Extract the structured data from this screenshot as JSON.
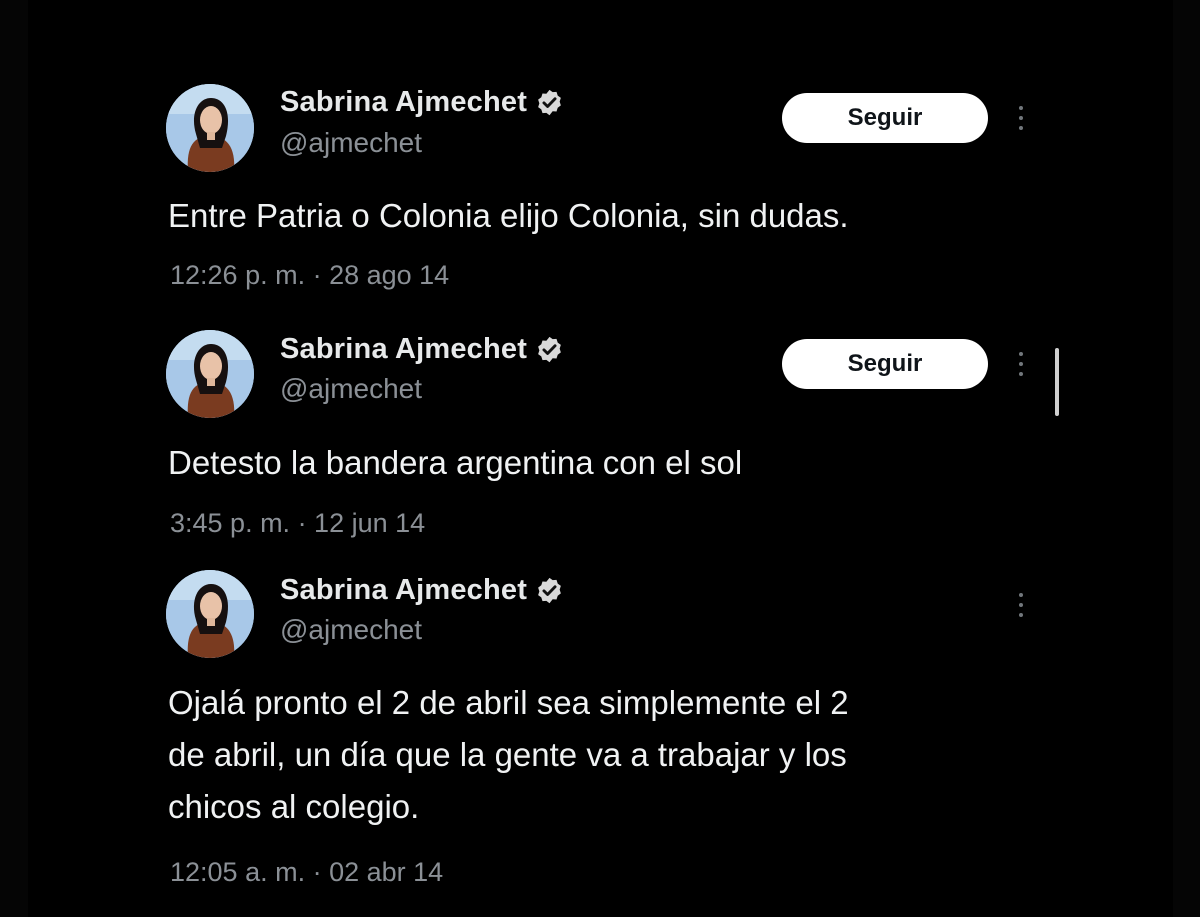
{
  "colors": {
    "background": "#000000",
    "verified_badge": "#d9d9d9",
    "follow_button_bg": "#ffffff",
    "text_primary": "#e7e9ea",
    "text_secondary": "#8b9096"
  },
  "tweets": [
    {
      "author": {
        "name": "Sabrina Ajmechet",
        "handle": "@ajmechet",
        "verified_icon": "verified-badge-icon",
        "avatar_icon": "avatar"
      },
      "follow_label": "Seguir",
      "more_icon": "more-options-icon",
      "text": "Entre Patria o Colonia elijo Colonia, sin dudas.",
      "timestamp": "12:26 p. m. · 28 ago 14"
    },
    {
      "author": {
        "name": "Sabrina Ajmechet",
        "handle": "@ajmechet",
        "verified_icon": "verified-badge-icon",
        "avatar_icon": "avatar"
      },
      "follow_label": "Seguir",
      "more_icon": "more-options-icon",
      "text": "Detesto la bandera argentina con el sol",
      "timestamp": "3:45 p. m. · 12 jun 14"
    },
    {
      "author": {
        "name": "Sabrina Ajmechet",
        "handle": "@ajmechet",
        "verified_icon": "verified-badge-icon",
        "avatar_icon": "avatar"
      },
      "more_icon": "more-options-icon",
      "text_lines": [
        "Ojalá pronto el 2 de abril sea simplemente el 2",
        "de abril, un día que la gente va a trabajar y los",
        "chicos al colegio."
      ],
      "timestamp": "12:05 a. m. · 02 abr 14"
    }
  ]
}
